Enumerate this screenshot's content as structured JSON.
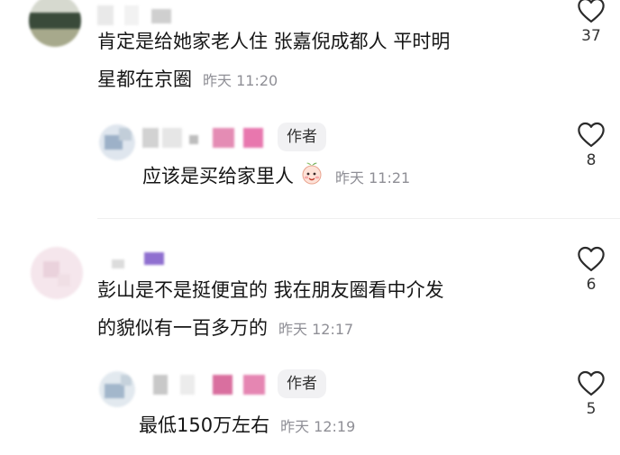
{
  "comments": [
    {
      "text_line1": "肯定是给她家老人住 张嘉倪成都人 平时明",
      "text_line2": "星都在京圈",
      "time": "昨天 11:20",
      "likes": "37"
    },
    {
      "author_tag": "作者",
      "text": "应该是买给家里人",
      "time": "昨天 11:21",
      "likes": "8",
      "emoji": "peach-face-emoji"
    },
    {
      "text_line1": "彭山是不是挺便宜的 我在朋友圈看中介发",
      "text_line2": "的貌似有一百多万的",
      "time": "昨天 12:17",
      "likes": "6"
    },
    {
      "author_tag": "作者",
      "text": "最低150万左右",
      "time": "昨天 12:19",
      "likes": "5"
    }
  ],
  "icons": {
    "like": "heart-outline-icon"
  },
  "colors": {
    "author_tag_bg": "#f1f1f3",
    "time": "#8f8f96"
  }
}
